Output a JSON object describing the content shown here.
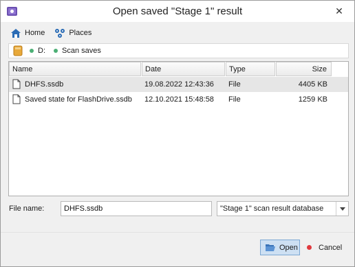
{
  "window": {
    "title": "Open saved \"Stage 1\" result",
    "close_glyph": "✕"
  },
  "toolbar": {
    "home_label": "Home",
    "places_label": "Places"
  },
  "path": {
    "drive": "D:",
    "folder": "Scan saves"
  },
  "columns": {
    "name": "Name",
    "date": "Date",
    "type": "Type",
    "size": "Size"
  },
  "files": [
    {
      "name": "DHFS.ssdb",
      "date": "19.08.2022 12:43:36",
      "type": "File",
      "size": "4405 KB",
      "selected": true
    },
    {
      "name": "Saved state for FlashDrive.ssdb",
      "date": "12.10.2021 15:48:58",
      "type": "File",
      "size": "1259 KB",
      "selected": false
    }
  ],
  "filename": {
    "label": "File name:",
    "value": "DHFS.ssdb"
  },
  "filetype": {
    "selected": "\"Stage 1\" scan result database"
  },
  "buttons": {
    "open_label": "Open",
    "cancel_label": "Cancel"
  },
  "colors": {
    "accent": "#cde0f3",
    "dot_green": "#4caf75",
    "cancel_red": "#e0393e"
  }
}
